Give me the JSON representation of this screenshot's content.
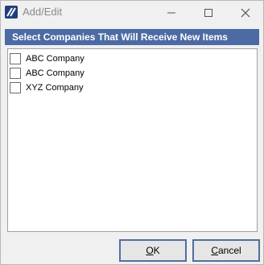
{
  "window": {
    "title": "Add/Edit"
  },
  "header": {
    "title": "Select Companies That Will Receive New Items"
  },
  "companies": [
    {
      "label": "ABC Company",
      "checked": false
    },
    {
      "label": "ABC Company",
      "checked": false
    },
    {
      "label": "XYZ Company",
      "checked": false
    }
  ],
  "buttons": {
    "ok_label": "OK",
    "cancel_label": "Cancel"
  },
  "colors": {
    "header_bg": "#4c6aa3",
    "button_border": "#536e9e",
    "app_icon": "#1f3f7a"
  }
}
